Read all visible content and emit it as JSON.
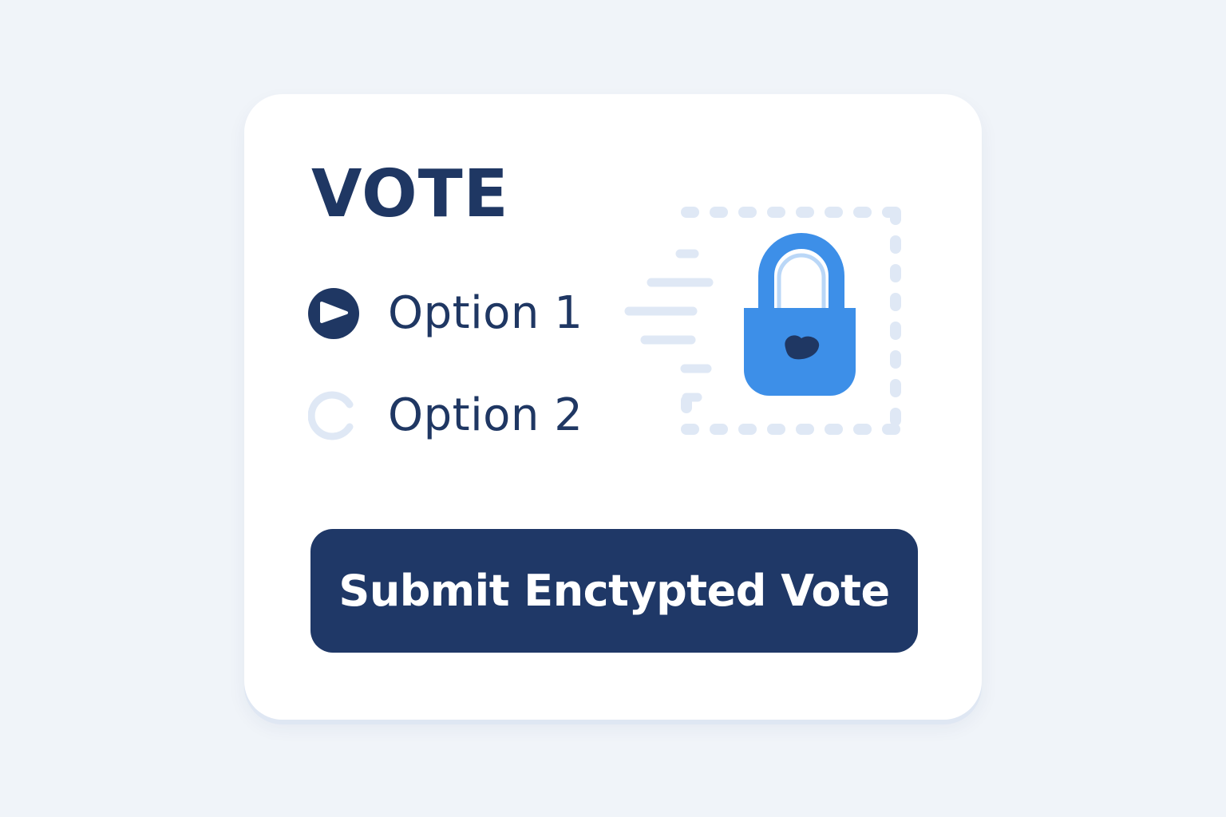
{
  "ballot": {
    "title": "VOTE",
    "options": [
      {
        "label": "Option 1",
        "selected": true
      },
      {
        "label": "Option 2",
        "selected": false
      }
    ],
    "submit_label": "Submit Enctypted Vote"
  },
  "icons": {
    "lock": "padlock-icon",
    "selected_radio": "play-icon",
    "frame": "dashed-frame"
  },
  "colors": {
    "background": "#f0f4f9",
    "card": "#ffffff",
    "primary": "#1f3867",
    "text": "#1f3763",
    "lock_blue": "#3d8fe8",
    "light_accent": "#dfe8f5"
  }
}
